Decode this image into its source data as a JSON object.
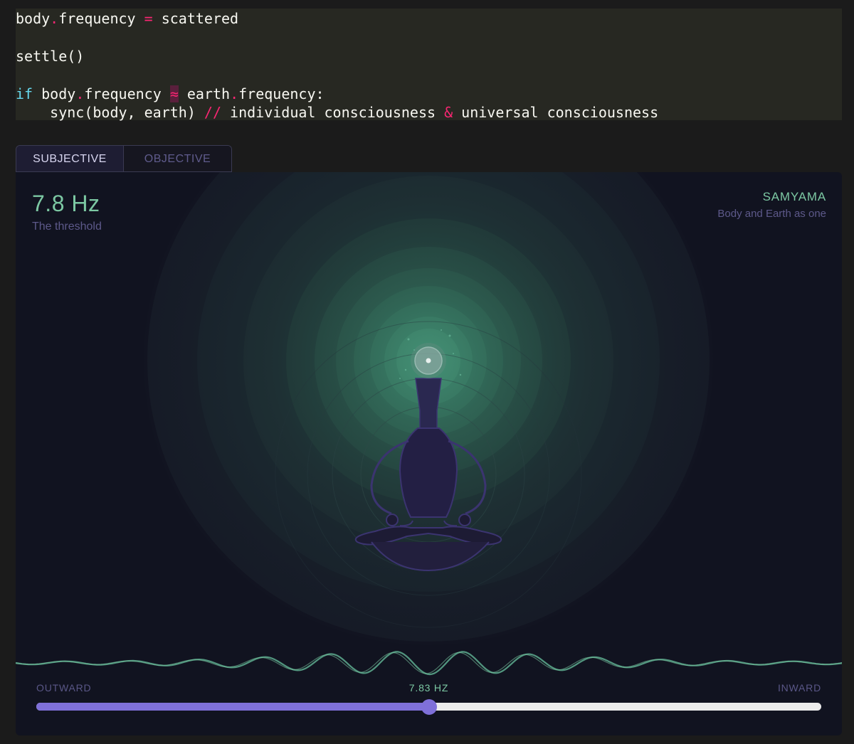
{
  "code": {
    "line1": {
      "a": "body",
      "dot": ".",
      "b": "frequency ",
      "op": "=",
      "c": " scattered"
    },
    "line2": "settle()",
    "line3": {
      "kw": "if",
      "a": " body",
      "dot1": ".",
      "b": "frequency ",
      "approx": "≈",
      "c": " earth",
      "dot2": ".",
      "d": "frequency:"
    },
    "line4": {
      "a": "    sync(body, earth) ",
      "comment": "//",
      "b": " individual consciousness ",
      "amp": "&",
      "c": " universal consciousness"
    }
  },
  "tabs": [
    {
      "label": "SUBJECTIVE",
      "active": true
    },
    {
      "label": "OBJECTIVE",
      "active": false
    }
  ],
  "readout": {
    "value": "7.8 Hz",
    "caption": "The threshold"
  },
  "state": {
    "name": "SAMYAMA",
    "caption": "Body and Earth as one"
  },
  "slider": {
    "left_label": "OUTWARD",
    "value_label": "7.83 HZ",
    "right_label": "INWARD",
    "fraction": 0.5
  },
  "colors": {
    "accent": "#7f70d9",
    "wave": "#5aa58a",
    "figure": "#3b3470",
    "glow": "#4aa88a"
  },
  "icons": {
    "figure": "meditating-figure-icon",
    "crown": "crown-orb-icon"
  }
}
